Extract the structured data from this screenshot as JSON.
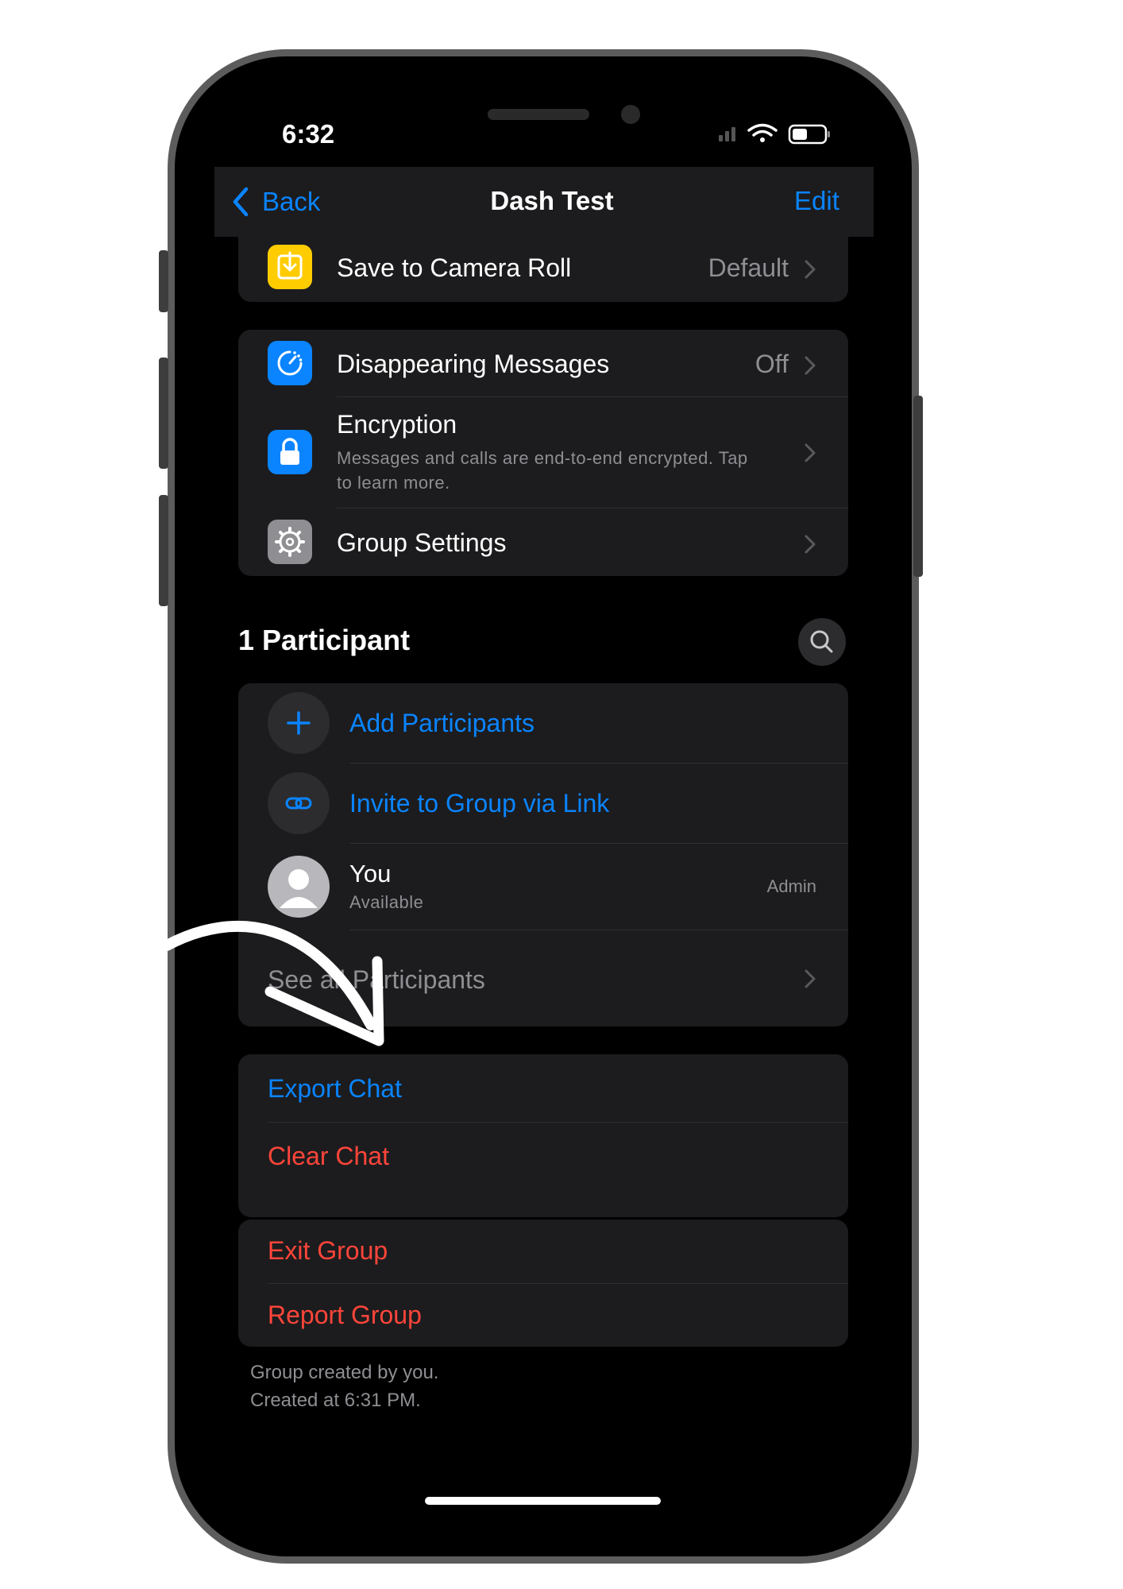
{
  "status": {
    "time": "6:32"
  },
  "nav": {
    "back_label": "Back",
    "title": "Dash Test",
    "edit_label": "Edit"
  },
  "media": {
    "save_label": "Save to Camera Roll",
    "save_value": "Default",
    "icon": "download-icon",
    "icon_color": "#ffcc00"
  },
  "privacy": {
    "disappearing_label": "Disappearing Messages",
    "disappearing_value": "Off",
    "encryption_label": "Encryption",
    "encryption_sub_line1": "Messages and calls are end-to-end encrypted. Tap",
    "encryption_sub_line2": "to learn more.",
    "group_settings_label": "Group Settings"
  },
  "participants": {
    "title": "1 Participant",
    "add_label": "Add Participants",
    "invite_label": "Invite to Group via Link",
    "you_name": "You",
    "you_status": "Available",
    "you_role": "Admin",
    "see_all_label": "See all Participants"
  },
  "actions": {
    "export_label": "Export Chat",
    "clear_label": "Clear Chat"
  },
  "danger": {
    "exit_label": "Exit Group",
    "report_label": "Report Group"
  },
  "footer": {
    "line1": "Group created by you.",
    "line2": "Created at 6:31 PM."
  },
  "colors": {
    "accent": "#0a84ff",
    "destructive": "#ff453a",
    "card": "#1c1c1e",
    "background": "#000000"
  }
}
